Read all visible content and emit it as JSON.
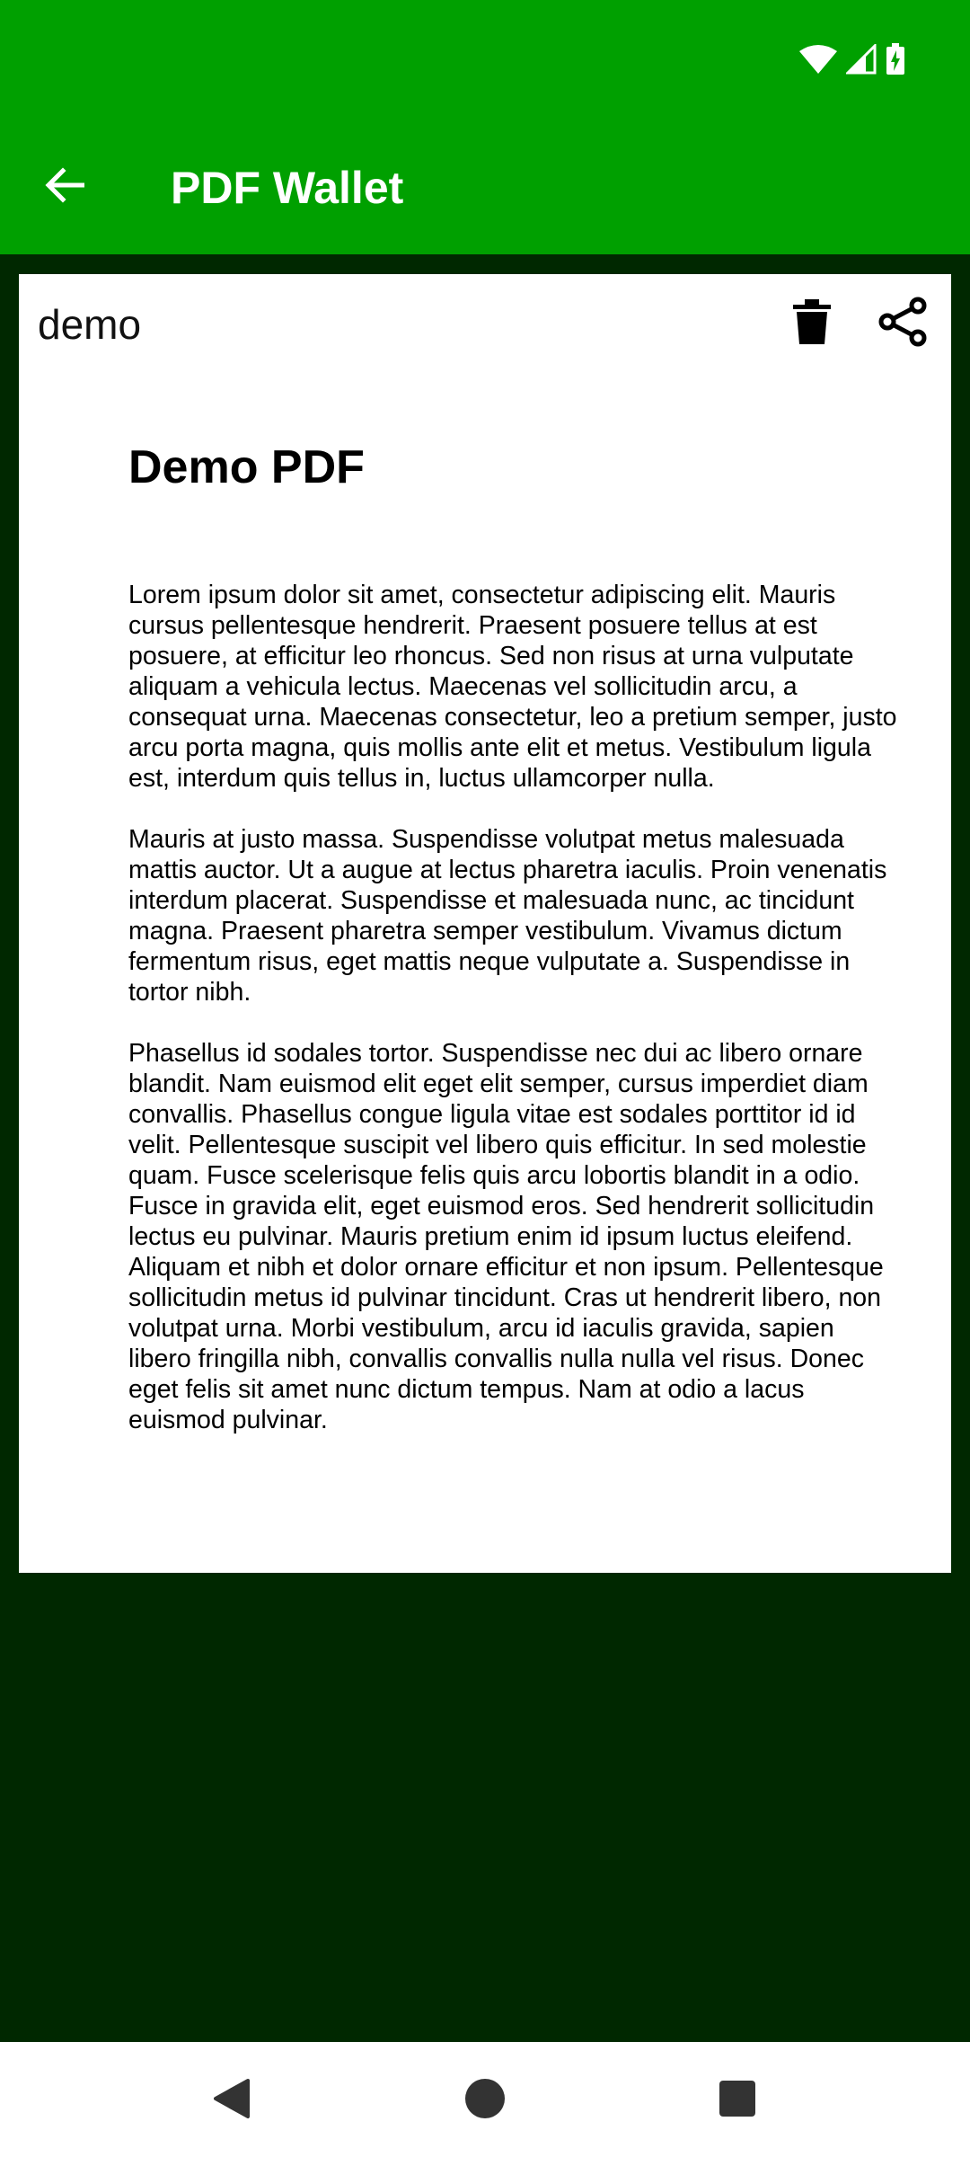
{
  "colors": {
    "app_bar": "#00a000",
    "background": "#002800",
    "card": "#ffffff",
    "text": "#000000"
  },
  "status_bar": {
    "icons": [
      "wifi-icon",
      "cell-signal-icon",
      "battery-charging-icon"
    ]
  },
  "app_bar": {
    "title": "PDF Wallet",
    "back_icon": "arrow-back-icon"
  },
  "document": {
    "name": "demo",
    "actions": [
      "delete-icon",
      "share-icon"
    ],
    "pdf": {
      "heading": "Demo PDF",
      "paragraphs": [
        "Lorem ipsum dolor sit amet, consectetur adipiscing elit. Mauris cursus pellentesque hendrerit. Praesent posuere tellus at est posuere, at efficitur leo rhoncus. Sed non risus at urna vulputate aliquam a vehicula lectus. Maecenas vel sollicitudin arcu, a consequat urna. Maecenas consectetur, leo a pretium semper, justo arcu porta magna, quis mollis ante elit et metus. Vestibulum ligula est, interdum quis tellus in, luctus ullamcorper nulla.",
        "Mauris at justo massa. Suspendisse volutpat metus malesuada mattis auctor. Ut a augue at lectus pharetra iaculis. Proin venenatis interdum placerat. Suspendisse et malesuada nunc, ac tincidunt magna. Praesent pharetra semper vestibulum. Vivamus dictum fermentum risus, eget mattis neque vulputate a. Suspendisse in tortor nibh.",
        "Phasellus id sodales tortor. Suspendisse nec dui ac libero ornare blandit. Nam euismod elit eget elit semper, cursus imperdiet diam convallis. Phasellus congue ligula vitae est sodales porttitor id id velit. Pellentesque suscipit vel libero quis efficitur. In sed molestie quam. Fusce scelerisque felis quis arcu lobortis blandit in a odio. Fusce in gravida elit, eget euismod eros. Sed hendrerit sollicitudin lectus eu pulvinar. Mauris pretium enim id ipsum luctus eleifend. Aliquam et nibh et dolor ornare efficitur et non ipsum. Pellentesque sollicitudin metus id pulvinar tincidunt. Cras ut hendrerit libero, non volutpat urna. Morbi vestibulum, arcu id iaculis gravida, sapien libero fringilla nibh, convallis convallis nulla nulla vel risus. Donec eget felis sit amet nunc dictum tempus. Nam at odio a lacus euismod pulvinar."
      ]
    }
  },
  "nav_bar": {
    "buttons": [
      "nav-back-icon",
      "nav-home-icon",
      "nav-recents-icon"
    ]
  }
}
